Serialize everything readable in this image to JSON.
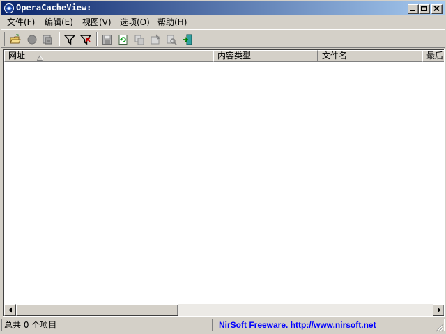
{
  "window": {
    "title": "OperaCacheView:"
  },
  "menu": {
    "items": [
      {
        "label": "文件(F)"
      },
      {
        "label": "编辑(E)"
      },
      {
        "label": "视图(V)"
      },
      {
        "label": "选项(O)"
      },
      {
        "label": "帮助(H)"
      }
    ]
  },
  "toolbar": {
    "buttons": [
      {
        "icon": "open-folder-icon"
      },
      {
        "icon": "stop-icon"
      },
      {
        "icon": "refresh-cache-icon"
      },
      {
        "icon": "filter-icon"
      },
      {
        "icon": "clear-filter-icon"
      },
      {
        "icon": "save-icon"
      },
      {
        "icon": "reload-icon"
      },
      {
        "icon": "copy-icon"
      },
      {
        "icon": "properties-icon"
      },
      {
        "icon": "find-icon"
      },
      {
        "icon": "exit-icon"
      }
    ]
  },
  "list": {
    "columns": [
      {
        "label": "网址"
      },
      {
        "label": "内容类型"
      },
      {
        "label": "文件名"
      },
      {
        "label": "最后"
      }
    ],
    "rows": []
  },
  "status": {
    "count_text": "总共 0 个项目",
    "link_text": "NirSoft Freeware.  http://www.nirsoft.net"
  },
  "colors": {
    "titlebar_start": "#0a246a",
    "titlebar_end": "#a6caf0",
    "face": "#d4d0c8",
    "link": "#0000ff"
  }
}
